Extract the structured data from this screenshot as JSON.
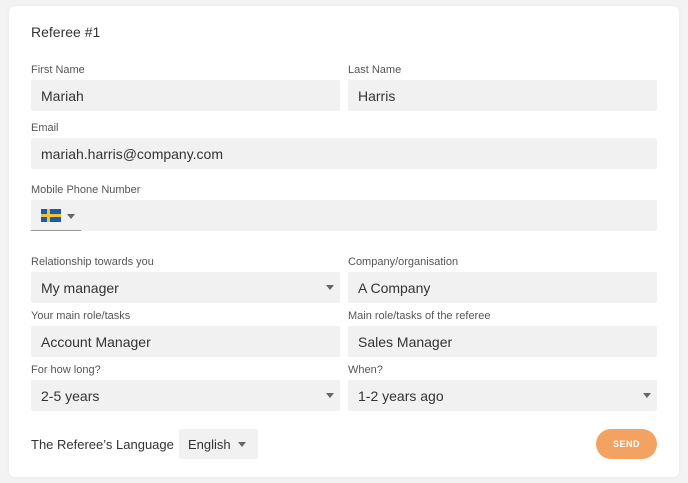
{
  "form": {
    "heading": "Referee #1",
    "first_name": {
      "label": "First Name",
      "value": "Mariah"
    },
    "last_name": {
      "label": "Last Name",
      "value": "Harris"
    },
    "email": {
      "label": "Email",
      "value": "mariah.harris@company.com"
    },
    "phone": {
      "label": "Mobile Phone Number",
      "value": "",
      "country_flag": "sweden-flag"
    },
    "relationship": {
      "label": "Relationship towards you",
      "value": "My manager"
    },
    "company": {
      "label": "Company/organisation",
      "value": "A Company"
    },
    "your_role": {
      "label": "Your main role/tasks",
      "value": "Account Manager"
    },
    "referee_role": {
      "label": "Main role/tasks of the referee",
      "value": "Sales Manager"
    },
    "how_long": {
      "label": "For how long?",
      "value": "2-5 years"
    },
    "when": {
      "label": "When?",
      "value": "1-2 years ago"
    },
    "language": {
      "label": "The Referee’s Language",
      "value": "English"
    },
    "send_label": "SEND"
  },
  "colors": {
    "accent": "#f4a261",
    "field_bg": "#f1f1f1",
    "flag_blue": "#1d5aa8",
    "flag_yellow": "#f4c430"
  }
}
